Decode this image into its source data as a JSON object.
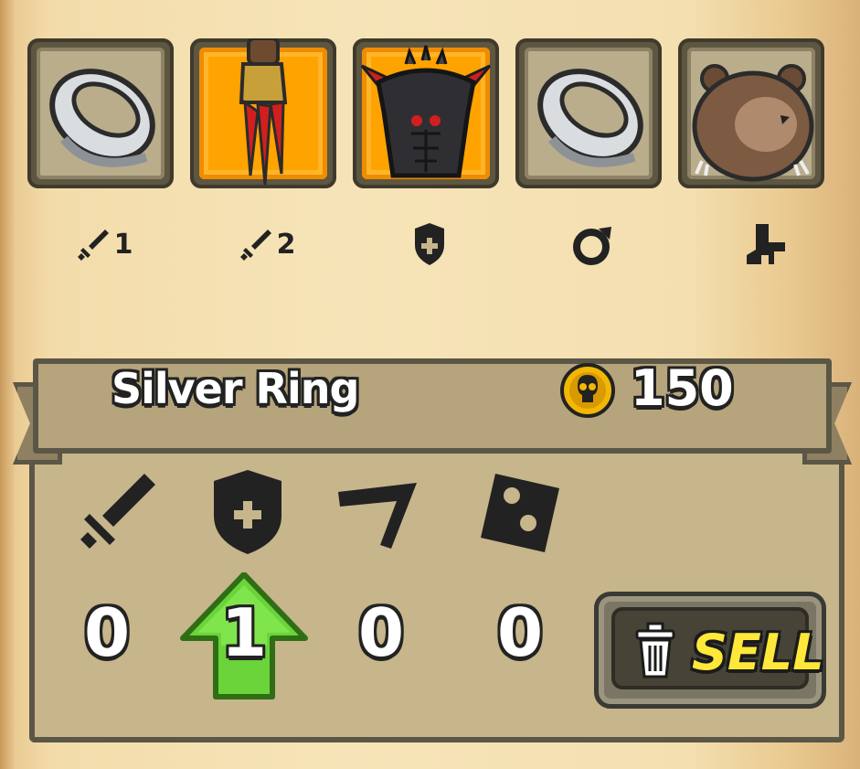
{
  "equipment_slots": [
    {
      "item": "silver-ring",
      "label": "1",
      "slot_icon": "sword-icon"
    },
    {
      "item": "claw-gauntlet",
      "label": "2",
      "slot_icon": "sword-icon",
      "rarity_color": "#ffa300"
    },
    {
      "item": "spiked-armor",
      "label": "",
      "slot_icon": "shield-icon",
      "rarity_color": "#ffa300"
    },
    {
      "item": "silver-ring",
      "label": "",
      "slot_icon": "ring-icon"
    },
    {
      "item": "bear-companion",
      "label": "",
      "slot_icon": "boot-icon"
    }
  ],
  "selected_item": {
    "name": "Silver Ring",
    "price": "150",
    "currency_icon": "skull-coin-icon"
  },
  "stats": [
    {
      "icon": "sword-icon",
      "value": "0"
    },
    {
      "icon": "shield-icon",
      "value": "1",
      "change": "up",
      "indicator_color": "#6ad43a"
    },
    {
      "icon": "boomerang-icon",
      "value": "0"
    },
    {
      "icon": "dice-icon",
      "value": "0"
    }
  ],
  "sell_button": {
    "label": "SELL",
    "icon": "trash-icon",
    "label_color": "#ffe83a"
  }
}
